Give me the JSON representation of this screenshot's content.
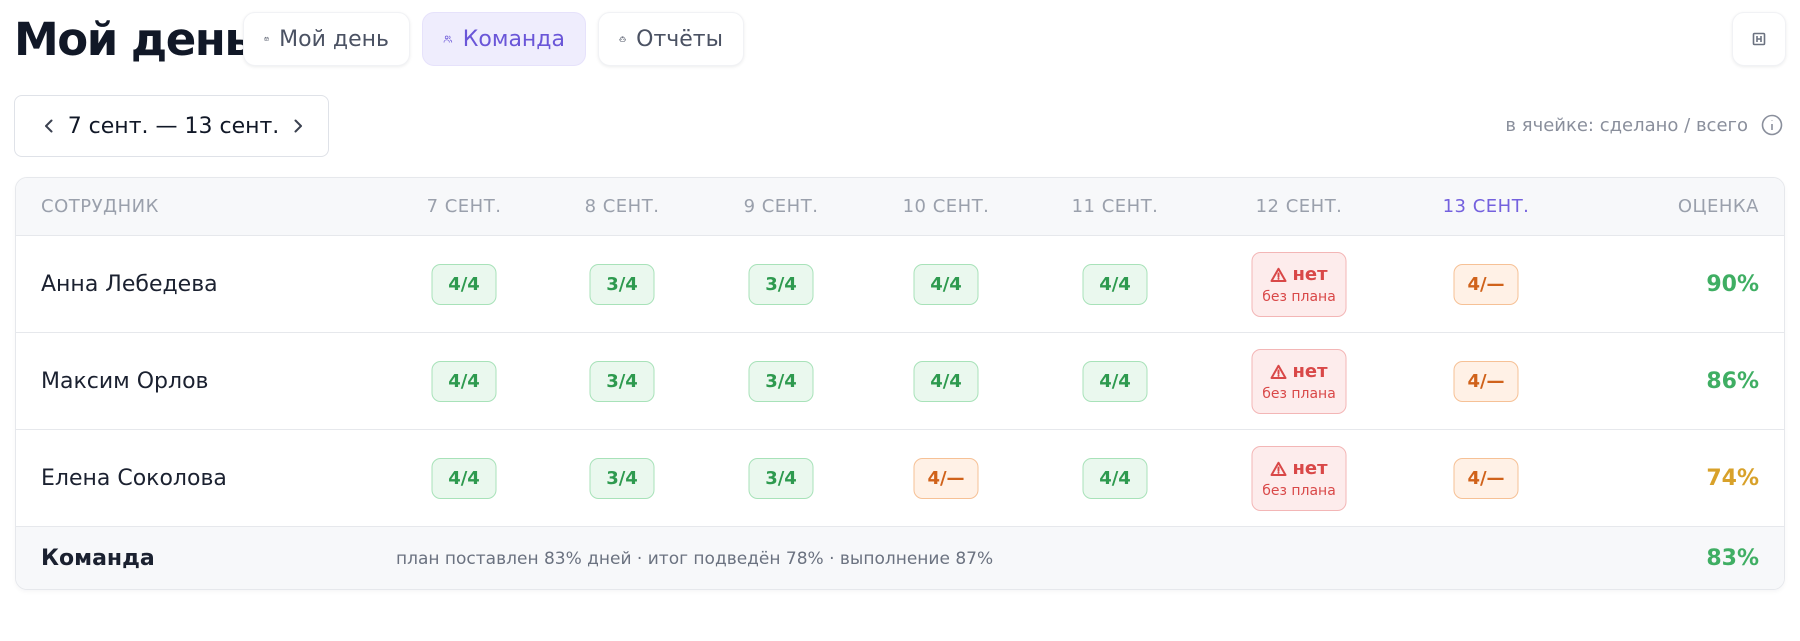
{
  "header": {
    "title": "Мой день",
    "tabs": [
      {
        "label": "Мой день",
        "icon": "calendar-icon",
        "active": false
      },
      {
        "label": "Команда",
        "icon": "users-icon",
        "active": true
      },
      {
        "label": "Отчёты",
        "icon": "robot-icon",
        "active": false
      }
    ],
    "corner_icon": "panel-icon"
  },
  "range": {
    "label": "7 сент. — 13 сент.",
    "prev_icon": "chevron-left-icon",
    "next_icon": "chevron-right-icon"
  },
  "hint": {
    "text": "в ячейке: сделано / всего",
    "icon": "info-icon"
  },
  "table": {
    "columns": [
      "СОТРУДНИК",
      "7 СЕНТ.",
      "8 СЕНТ.",
      "9 СЕНТ.",
      "10 СЕНТ.",
      "11 СЕНТ.",
      "12 СЕНТ.",
      "13 СЕНТ.",
      "ОЦЕНКА"
    ],
    "today_column": "13 СЕНТ.",
    "no_plan": {
      "label": "нет",
      "sub": "без плана",
      "icon": "warning-icon"
    },
    "rows": [
      {
        "name": "Анна Лебедева",
        "cells": [
          {
            "text": "4/4",
            "status": "ok"
          },
          {
            "text": "3/4",
            "status": "ok"
          },
          {
            "text": "3/4",
            "status": "ok"
          },
          {
            "text": "4/4",
            "status": "ok"
          },
          {
            "text": "4/4",
            "status": "ok"
          },
          {
            "text": "нет",
            "status": "none"
          },
          {
            "text": "4/—",
            "status": "warn"
          }
        ],
        "score": "90%",
        "score_color": "#3fae63"
      },
      {
        "name": "Максим Орлов",
        "cells": [
          {
            "text": "4/4",
            "status": "ok"
          },
          {
            "text": "3/4",
            "status": "ok"
          },
          {
            "text": "3/4",
            "status": "ok"
          },
          {
            "text": "4/4",
            "status": "ok"
          },
          {
            "text": "4/4",
            "status": "ok"
          },
          {
            "text": "нет",
            "status": "none"
          },
          {
            "text": "4/—",
            "status": "warn"
          }
        ],
        "score": "86%",
        "score_color": "#3fae63"
      },
      {
        "name": "Елена Соколова",
        "cells": [
          {
            "text": "4/4",
            "status": "ok"
          },
          {
            "text": "3/4",
            "status": "ok"
          },
          {
            "text": "3/4",
            "status": "ok"
          },
          {
            "text": "4/—",
            "status": "warn"
          },
          {
            "text": "4/4",
            "status": "ok"
          },
          {
            "text": "нет",
            "status": "none"
          },
          {
            "text": "4/—",
            "status": "warn"
          }
        ],
        "score": "74%",
        "score_color": "#d8a12a"
      }
    ],
    "footer": {
      "label": "Команда",
      "stats": "план поставлен 83% дней · итог подведён 78% · выполнение 87%",
      "score": "83%"
    }
  },
  "colors": {
    "accent": "#6a56d8",
    "ok": "#2e9a4f",
    "warn": "#d0621a",
    "danger": "#d94848"
  }
}
